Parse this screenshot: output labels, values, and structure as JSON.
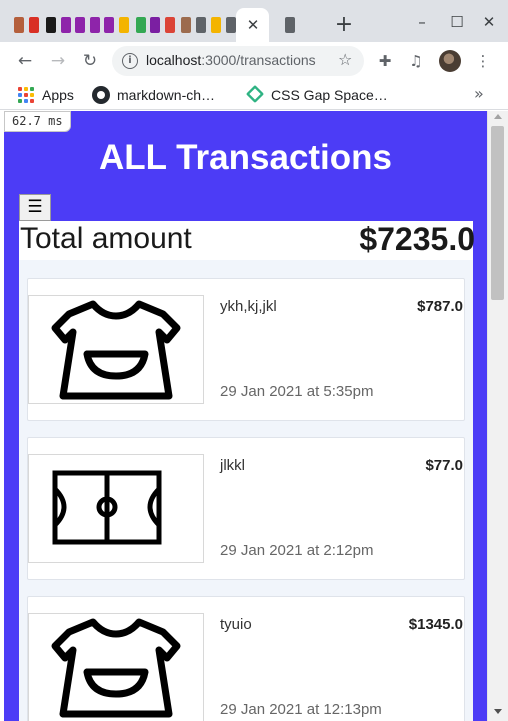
{
  "browser": {
    "tab_colors": [
      "#b45f3c",
      "#d93025",
      "#1a1a1a",
      "#8e24aa",
      "#8e24aa",
      "#8e24aa",
      "#8e24aa",
      "#f4b400",
      "#34a853",
      "#7b1fa2",
      "#db4437",
      "#9c6b4e",
      "#5f6368",
      "#f4b400",
      "#5f6368",
      "#5f6368"
    ],
    "tab_close_glyph": "✕",
    "newtab_glyph": "+",
    "url_host": "localhost",
    "url_rest": ":3000/transactions",
    "bookmarks": [
      {
        "label": "Apps",
        "icon": "apps-grid-icon"
      },
      {
        "label": "markdown-ch…",
        "icon": "github-icon"
      },
      {
        "label": "CSS Gap Space…",
        "icon": "css-gap-icon"
      }
    ]
  },
  "timing": "62.7 ms",
  "page": {
    "title": "ALL Transactions",
    "menu_icon": "hamburger-menu-icon",
    "total_label": "Total amount",
    "total_value": "$7235.0"
  },
  "transactions": [
    {
      "name": "ykh,kj,jkl",
      "amount": "$787.0",
      "date": "29 Jan 2021 at 5:35pm",
      "icon": "shirt-icon"
    },
    {
      "name": "jlkkl",
      "amount": "$77.0",
      "date": "29 Jan 2021 at 2:12pm",
      "icon": "football-field-icon"
    },
    {
      "name": "tyuio",
      "amount": "$1345.0",
      "date": "29 Jan 2021 at 12:13pm",
      "icon": "shirt-icon"
    }
  ],
  "colors": {
    "page_background": "#4c3cf6",
    "content_background": "#f1f5fb"
  }
}
